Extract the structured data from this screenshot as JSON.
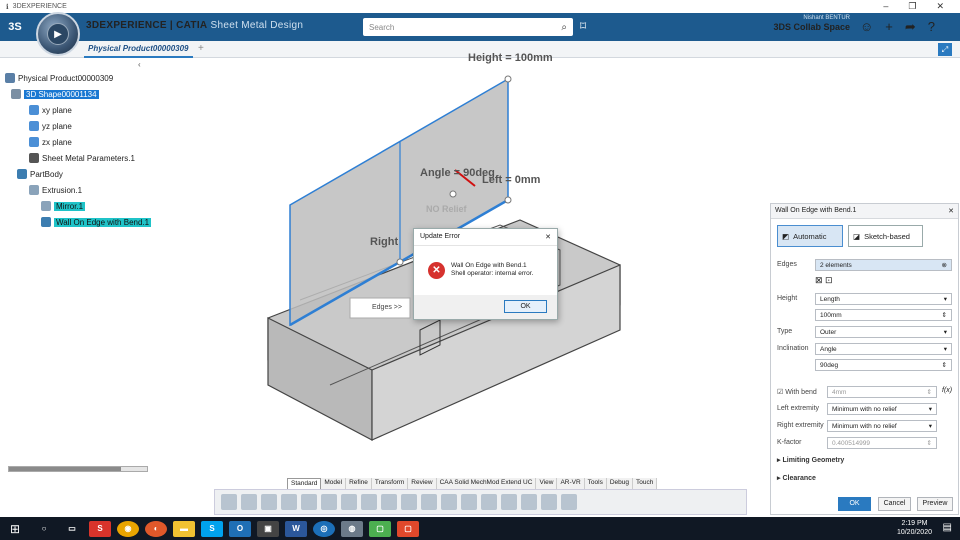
{
  "window": {
    "title": "3DEXPERIENCE"
  },
  "header": {
    "brand_prefix": "3DEXPERIENCE | ",
    "brand_name": "CATIA",
    "app_name": "Sheet Metal Design",
    "search_placeholder": "Search",
    "user_name": "Nishant BENTUR",
    "collab_space": "3DS Collab Space"
  },
  "tabs": {
    "active": "Physical Product00000309",
    "plus": "+"
  },
  "tree": {
    "root": "Physical Product00000309",
    "shape": "3D Shape00001134",
    "xy": "xy plane",
    "yz": "yz plane",
    "zx": "zx plane",
    "sheet": "Sheet Metal Parameters.1",
    "partbody": "PartBody",
    "extrusion": "Extrusion.1",
    "mirror": "Mirror.1",
    "wall": "Wall On Edge with Bend.1"
  },
  "annotations": {
    "height": "Height = 100mm",
    "angle": "Angle = 90deg",
    "left": "Left = 0mm",
    "right": "Right",
    "no_relief": "NO Relief",
    "edges": "Edges >>"
  },
  "dialog": {
    "title": "Update Error",
    "line1": "Wall On Edge with Bend.1",
    "line2": "Shell operator: internal error.",
    "ok": "OK"
  },
  "panel": {
    "title": "Wall On Edge with Bend.1",
    "automatic": "Automatic",
    "sketch_based": "Sketch-based",
    "edges_label": "Edges",
    "edges_value": "2 elements",
    "height_label": "Height",
    "height_type": "Length",
    "height_value": "100mm",
    "type_label": "Type",
    "type_value": "Outer",
    "inclination_label": "Inclination",
    "inclination_type": "Angle",
    "inclination_value": "90deg",
    "with_bend": "With bend",
    "bend_value": "4mm",
    "left_ext_label": "Left extremity",
    "left_ext_value": "Minimum with no relief",
    "right_ext_label": "Right extremity",
    "right_ext_value": "Minimum with no relief",
    "kfactor_label": "K-factor",
    "kfactor_value": "0.400514999",
    "limiting": "Limiting Geometry",
    "clearance": "Clearance",
    "ok": "OK",
    "cancel": "Cancel",
    "preview": "Preview"
  },
  "action_tabs": [
    "Standard",
    "Model",
    "Refine",
    "Transform",
    "Review",
    "CAA Solid MechMod Extend UC",
    "View",
    "AR-VR",
    "Tools",
    "Debug",
    "Touch"
  ],
  "taskbar": {
    "time": "2:19 PM",
    "date": "10/20/2020"
  }
}
